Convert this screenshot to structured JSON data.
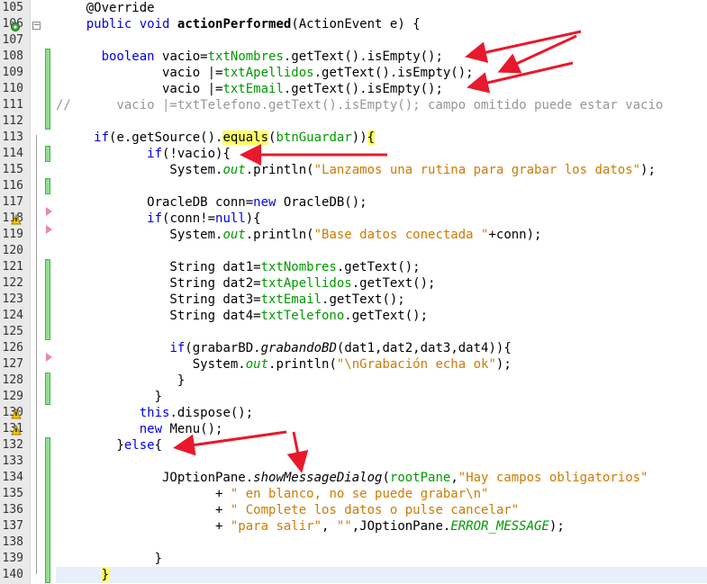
{
  "editor": {
    "lines": [
      {
        "n": "105",
        "segments": [
          {
            "t": "    "
          },
          {
            "t": "@Override"
          }
        ]
      },
      {
        "n": "106",
        "segments": [
          {
            "t": "    "
          },
          {
            "t": "public",
            "c": "kw"
          },
          {
            "t": " "
          },
          {
            "t": "void",
            "c": "kw"
          },
          {
            "t": " "
          },
          {
            "t": "actionPerformed",
            "c": "b"
          },
          {
            "t": "(ActionEvent e) {"
          }
        ]
      },
      {
        "n": "107",
        "segments": [
          {
            "t": ""
          }
        ]
      },
      {
        "n": "108",
        "segments": [
          {
            "t": "      "
          },
          {
            "t": "boolean",
            "c": "kw"
          },
          {
            "t": " vacio="
          },
          {
            "t": "txtNombres",
            "c": "fld"
          },
          {
            "t": ".getText().isEmpty();"
          }
        ]
      },
      {
        "n": "109",
        "segments": [
          {
            "t": "              vacio |="
          },
          {
            "t": "txtApellidos",
            "c": "fld"
          },
          {
            "t": ".getText().isEmpty();"
          }
        ]
      },
      {
        "n": "110",
        "segments": [
          {
            "t": "              vacio |="
          },
          {
            "t": "txtEmail",
            "c": "fld"
          },
          {
            "t": ".getText().isEmpty();"
          }
        ]
      },
      {
        "n": "111",
        "segments": [
          {
            "t": "//      vacio |=txtTelefono.getText().isEmpty(); campo omitido puede estar vacio",
            "c": "cmt"
          }
        ]
      },
      {
        "n": "112",
        "segments": [
          {
            "t": ""
          }
        ]
      },
      {
        "n": "113",
        "segments": [
          {
            "t": "     "
          },
          {
            "t": "if",
            "c": "kw"
          },
          {
            "t": "(e.getSource()."
          },
          {
            "t": "equals",
            "c": "hl"
          },
          {
            "t": "("
          },
          {
            "t": "btnGuardar",
            "c": "fld"
          },
          {
            "t": "))"
          },
          {
            "t": "{",
            "c": "hl"
          }
        ]
      },
      {
        "n": "114",
        "segments": [
          {
            "t": "            "
          },
          {
            "t": "if",
            "c": "kw"
          },
          {
            "t": "(!vacio){"
          }
        ]
      },
      {
        "n": "115",
        "segments": [
          {
            "t": "               System."
          },
          {
            "t": "out",
            "c": "out"
          },
          {
            "t": ".println("
          },
          {
            "t": "\"Lanzamos una rutina para grabar los datos\"",
            "c": "str"
          },
          {
            "t": ");"
          }
        ]
      },
      {
        "n": "116",
        "segments": [
          {
            "t": ""
          }
        ]
      },
      {
        "n": "117",
        "segments": [
          {
            "t": "            OracleDB conn="
          },
          {
            "t": "new",
            "c": "kw"
          },
          {
            "t": " OracleDB();"
          }
        ]
      },
      {
        "n": "118",
        "segments": [
          {
            "t": "            "
          },
          {
            "t": "if",
            "c": "kw"
          },
          {
            "t": "(conn!="
          },
          {
            "t": "null",
            "c": "kw"
          },
          {
            "t": "){"
          }
        ]
      },
      {
        "n": "119",
        "segments": [
          {
            "t": "               System."
          },
          {
            "t": "out",
            "c": "out"
          },
          {
            "t": ".println("
          },
          {
            "t": "\"Base datos conectada \"",
            "c": "str"
          },
          {
            "t": "+conn);"
          }
        ]
      },
      {
        "n": "120",
        "segments": [
          {
            "t": ""
          }
        ]
      },
      {
        "n": "121",
        "segments": [
          {
            "t": "               String dat1="
          },
          {
            "t": "txtNombres",
            "c": "fld"
          },
          {
            "t": ".getText();"
          }
        ]
      },
      {
        "n": "122",
        "segments": [
          {
            "t": "               String dat2="
          },
          {
            "t": "txtApellidos",
            "c": "fld"
          },
          {
            "t": ".getText();"
          }
        ]
      },
      {
        "n": "123",
        "segments": [
          {
            "t": "               String dat3="
          },
          {
            "t": "txtEmail",
            "c": "fld"
          },
          {
            "t": ".getText();"
          }
        ]
      },
      {
        "n": "124",
        "segments": [
          {
            "t": "               String dat4="
          },
          {
            "t": "txtTelefono",
            "c": "fld"
          },
          {
            "t": ".getText();"
          }
        ]
      },
      {
        "n": "125",
        "segments": [
          {
            "t": ""
          }
        ]
      },
      {
        "n": "126",
        "segments": [
          {
            "t": "               "
          },
          {
            "t": "if",
            "c": "kw"
          },
          {
            "t": "(grabarBD."
          },
          {
            "t": "grabandoBD",
            "c": "it"
          },
          {
            "t": "(dat1,dat2,dat3,dat4)){"
          }
        ]
      },
      {
        "n": "127",
        "segments": [
          {
            "t": "                  System."
          },
          {
            "t": "out",
            "c": "out"
          },
          {
            "t": ".println("
          },
          {
            "t": "\"\\nGrabación echa ok\"",
            "c": "str"
          },
          {
            "t": ");"
          }
        ]
      },
      {
        "n": "128",
        "segments": [
          {
            "t": "                }"
          }
        ]
      },
      {
        "n": "129",
        "segments": [
          {
            "t": "             }"
          }
        ]
      },
      {
        "n": "130",
        "segments": [
          {
            "t": "           "
          },
          {
            "t": "this",
            "c": "kw"
          },
          {
            "t": ".dispose();"
          }
        ]
      },
      {
        "n": "131",
        "segments": [
          {
            "t": "           "
          },
          {
            "t": "new",
            "c": "kw"
          },
          {
            "t": " Menu();"
          }
        ]
      },
      {
        "n": "132",
        "segments": [
          {
            "t": "        }"
          },
          {
            "t": "else",
            "c": "kw"
          },
          {
            "t": "{"
          }
        ]
      },
      {
        "n": "133",
        "segments": [
          {
            "t": ""
          }
        ]
      },
      {
        "n": "134",
        "segments": [
          {
            "t": "              JOptionPane."
          },
          {
            "t": "showMessageDialog",
            "c": "it"
          },
          {
            "t": "("
          },
          {
            "t": "rootPane",
            "c": "fld"
          },
          {
            "t": ","
          },
          {
            "t": "\"Hay campos obligatorios\"",
            "c": "str"
          }
        ]
      },
      {
        "n": "135",
        "segments": [
          {
            "t": "                     + "
          },
          {
            "t": "\" en blanco, no se puede grabar\\n\"",
            "c": "str"
          }
        ]
      },
      {
        "n": "136",
        "segments": [
          {
            "t": "                     + "
          },
          {
            "t": "\" Complete los datos o pulse cancelar\"",
            "c": "str"
          }
        ]
      },
      {
        "n": "137",
        "segments": [
          {
            "t": "                     + "
          },
          {
            "t": "\"para salir\"",
            "c": "str"
          },
          {
            "t": ", "
          },
          {
            "t": "\"\"",
            "c": "str"
          },
          {
            "t": ",JOptionPane."
          },
          {
            "t": "ERROR_MESSAGE",
            "c": "err"
          },
          {
            "t": ");"
          }
        ]
      },
      {
        "n": "138",
        "segments": [
          {
            "t": ""
          }
        ]
      },
      {
        "n": "139",
        "segments": [
          {
            "t": "             }"
          }
        ]
      },
      {
        "n": "140",
        "segments": [
          {
            "t": "      "
          },
          {
            "t": "}",
            "c": "hl"
          }
        ]
      }
    ]
  },
  "colors": {
    "arrow": "#e8192c",
    "keyword": "#0000e6",
    "field": "#009900",
    "string": "#ce7b00",
    "comment": "#969696"
  }
}
